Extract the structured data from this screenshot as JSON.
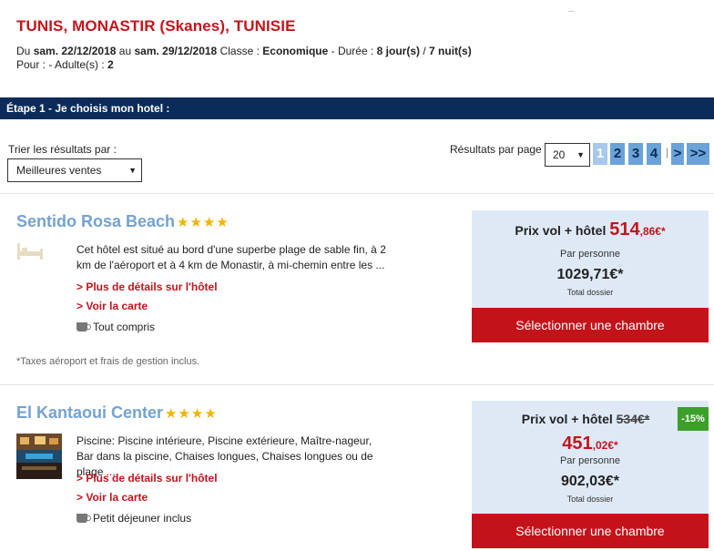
{
  "header": {
    "destination": "TUNIS, MONASTIR (Skanes), TUNISIE",
    "du_label": "Du",
    "date_from": "sam. 22/12/2018",
    "au_label": "au",
    "date_to": "sam. 29/12/2018",
    "classe_label": "Classe :",
    "classe_value": "Economique",
    "duree_label": "- Durée :",
    "days": "8 jour(s)",
    "nights": "7 nuit(s)",
    "pour_label": "Pour : - Adulte(s) :",
    "adults": "2"
  },
  "step": {
    "label": "Étape 1 - Je choisis mon hotel :"
  },
  "sort": {
    "label": "Trier les résultats par :",
    "selected": "Meilleures ventes"
  },
  "paging": {
    "label": "Résultats par page :",
    "per_page": "20",
    "pages": [
      "1",
      "2",
      "3",
      "4"
    ],
    "next": ">",
    "last": ">>",
    "separator": "|"
  },
  "hotels": [
    {
      "name": "Sentido Rosa Beach",
      "stars": "★★★★",
      "description": "Cet hôtel est situé au bord d'une superbe plage de sable fin, à 2 km de l'aéroport et à 4 km de Monastir, à mi-chemin entre les ...",
      "details_link": "> Plus de détails sur l'hôtel",
      "map_link": "> Voir la carte",
      "board": "Tout compris",
      "price_label": "Prix vol + hôtel",
      "price_main": "514",
      "price_cents": ",86€*",
      "per_person": "Par personne",
      "total": "1029,71€*",
      "total_label": "Total dossier",
      "button": "Sélectionner une chambre"
    },
    {
      "name": "El Kantaoui Center",
      "stars": "★★★★",
      "description": "Piscine: Piscine intérieure, Piscine extérieure, Maître-nageur, Bar dans la piscine, Chaises longues, Chaises longues ou de plage ...",
      "details_link": "> Plus de détails sur l'hôtel",
      "map_link": "> Voir la carte",
      "board": "Petit déjeuner inclus",
      "price_label": "Prix vol + hôtel",
      "old_price": "534€*",
      "discount": "-15%",
      "price_main": "451",
      "price_cents": ",02€*",
      "per_person": "Par personne",
      "total": "902,03€*",
      "total_label": "Total dossier",
      "button": "Sélectionner une chambre"
    }
  ],
  "taxes_note": "*Taxes aéroport et frais de gestion inclus."
}
